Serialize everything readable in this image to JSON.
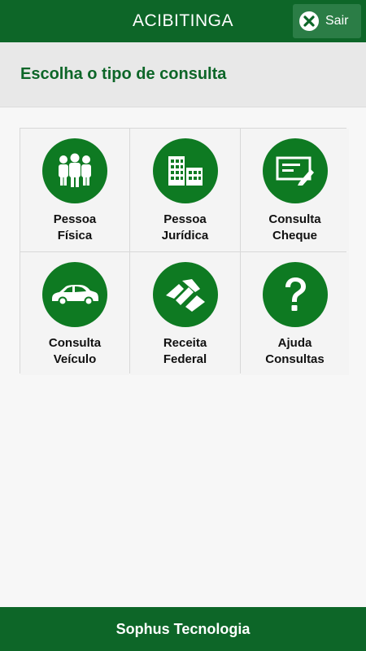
{
  "header": {
    "title": "ACIBITINGA",
    "exit_label": "Sair"
  },
  "subheader": {
    "title": "Escolha o tipo de consulta"
  },
  "tiles": [
    {
      "line1": "Pessoa",
      "line2": "Física",
      "icon": "people-icon"
    },
    {
      "line1": "Pessoa",
      "line2": "Jurídica",
      "icon": "buildings-icon"
    },
    {
      "line1": "Consulta",
      "line2": "Cheque",
      "icon": "check-icon"
    },
    {
      "line1": "Consulta",
      "line2": "Veículo",
      "icon": "car-icon"
    },
    {
      "line1": "Receita",
      "line2": "Federal",
      "icon": "receita-federal-icon"
    },
    {
      "line1": "Ajuda",
      "line2": "Consultas",
      "icon": "question-icon"
    }
  ],
  "footer": {
    "text": "Sophus Tecnologia"
  },
  "colors": {
    "brand_green": "#0d6628",
    "icon_circle": "#0e7a22",
    "button_green": "#2b7d46"
  }
}
